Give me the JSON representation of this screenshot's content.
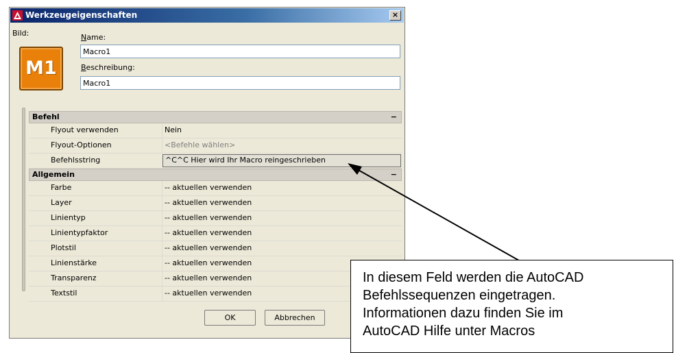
{
  "dialog": {
    "title": "Werkzeugeigenschaften",
    "close_glyph": "×",
    "image_label": "Bild:",
    "image_text": "M1",
    "name_label": "Name:",
    "name_value": "Macro1",
    "description_label": "Beschreibung:",
    "description_value": "Macro1"
  },
  "sections": [
    {
      "title": "Befehl",
      "collapse_glyph": "−",
      "rows": [
        {
          "name": "Flyout verwenden",
          "value": "Nein"
        },
        {
          "name": "Flyout-Optionen",
          "value": "<Befehle wählen>"
        },
        {
          "name": "Befehlsstring",
          "value": "^C^C Hier wird Ihr Macro reingeschrieben"
        }
      ]
    },
    {
      "title": "Allgemein",
      "collapse_glyph": "−",
      "rows": [
        {
          "name": "Farbe",
          "value": "-- aktuellen verwenden"
        },
        {
          "name": "Layer",
          "value": "-- aktuellen verwenden"
        },
        {
          "name": "Linientyp",
          "value": "-- aktuellen verwenden"
        },
        {
          "name": "Linientypfaktor",
          "value": "-- aktuellen verwenden"
        },
        {
          "name": "Plotstil",
          "value": "-- aktuellen verwenden"
        },
        {
          "name": "Linienstärke",
          "value": "-- aktuellen verwenden"
        },
        {
          "name": "Transparenz",
          "value": "-- aktuellen verwenden"
        },
        {
          "name": "Textstil",
          "value": "-- aktuellen verwenden"
        }
      ]
    }
  ],
  "buttons": {
    "ok": "OK",
    "cancel": "Abbrechen"
  },
  "callout": {
    "lines": [
      "In diesem Feld werden die AutoCAD",
      "Befehlssequenzen eingetragen.",
      "Informationen dazu finden Sie im",
      "AutoCAD Hilfe unter Macros"
    ]
  },
  "icons": {
    "app": "autocad-logo-icon",
    "close": "close-icon",
    "collapse": "collapse-minus-icon"
  },
  "colors": {
    "title_start": "#0a246a",
    "title_end": "#a6caf0",
    "macro_image": "#e8800a",
    "dialog_bg": "#ece9d8"
  }
}
